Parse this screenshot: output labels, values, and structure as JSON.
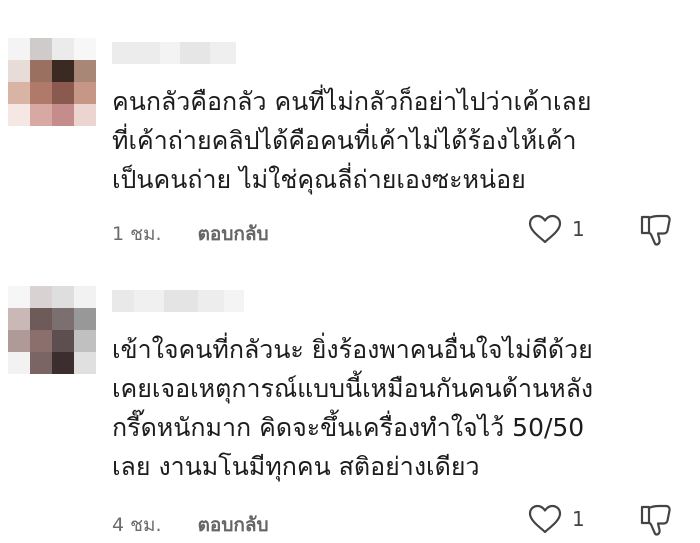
{
  "comments": [
    {
      "lines": [
        "คนกลัวคือกลัว คนที่ไม่กลัวก็อย่าไปว่าเค้าเลย",
        "ที่เค้าถ่ายคลิปได้คือคนที่เค้าไม่ได้ร้องไห้เค้า",
        "เป็นคนถ่าย ไม่ใช่คุณลี่ถ่ายเองซะหน่อย"
      ],
      "time": "1 ชม.",
      "reply_label": "ตอบกลับ",
      "like_count": "1",
      "like_icon": "heart-outline-icon",
      "dislike_icon": "thumbs-down-outline-icon",
      "avatar_pixels": [
        "#f4f4f4",
        "#cfcbca",
        "#ebebeb",
        "#f7f7f7",
        "#e8dcd8",
        "#9a7060",
        "#3a2a22",
        "#a88777",
        "#d9b3a4",
        "#b07a6a",
        "#8a5a50",
        "#c69686",
        "#f5e7e3",
        "#d8a9a3",
        "#c48c8a",
        "#ecd4d0"
      ],
      "username_pixels": [
        "#ececec",
        "#f3f3f3",
        "#e6e6e6",
        "#efefef"
      ]
    },
    {
      "lines": [
        "เข้าใจคนที่กลัวนะ ยิ่งร้องพาคนอื่นใจไม่ดีด้วย",
        "เคยเจอเหตุการณ์แบบนี้เหมือนกันคนด้านหลัง",
        "กรี๊ดหนักมาก คิดจะขึ้นเครื่องทำใจไว้ 50/50",
        "เลย งานมโนมีทุกคน สติอย่างเดียว"
      ],
      "time": "4 ชม.",
      "reply_label": "ตอบกลับ",
      "like_count": "1",
      "like_icon": "heart-outline-icon",
      "dislike_icon": "thumbs-down-outline-icon",
      "avatar_pixels": [
        "#f6f6f6",
        "#d8d3d2",
        "#dedede",
        "#f2f2f2",
        "#c9b8b6",
        "#6e5a58",
        "#7c6f6f",
        "#989898",
        "#b09a98",
        "#8a6f6d",
        "#5d4e50",
        "#c0c0c0",
        "#f2f2f2",
        "#7a6564",
        "#3c2e2e",
        "#e0e0e0"
      ],
      "username_pixels": [
        "#e9e9e9",
        "#f0f0f0",
        "#e4e4e4",
        "#ededed",
        "#f4f4f4"
      ]
    }
  ]
}
